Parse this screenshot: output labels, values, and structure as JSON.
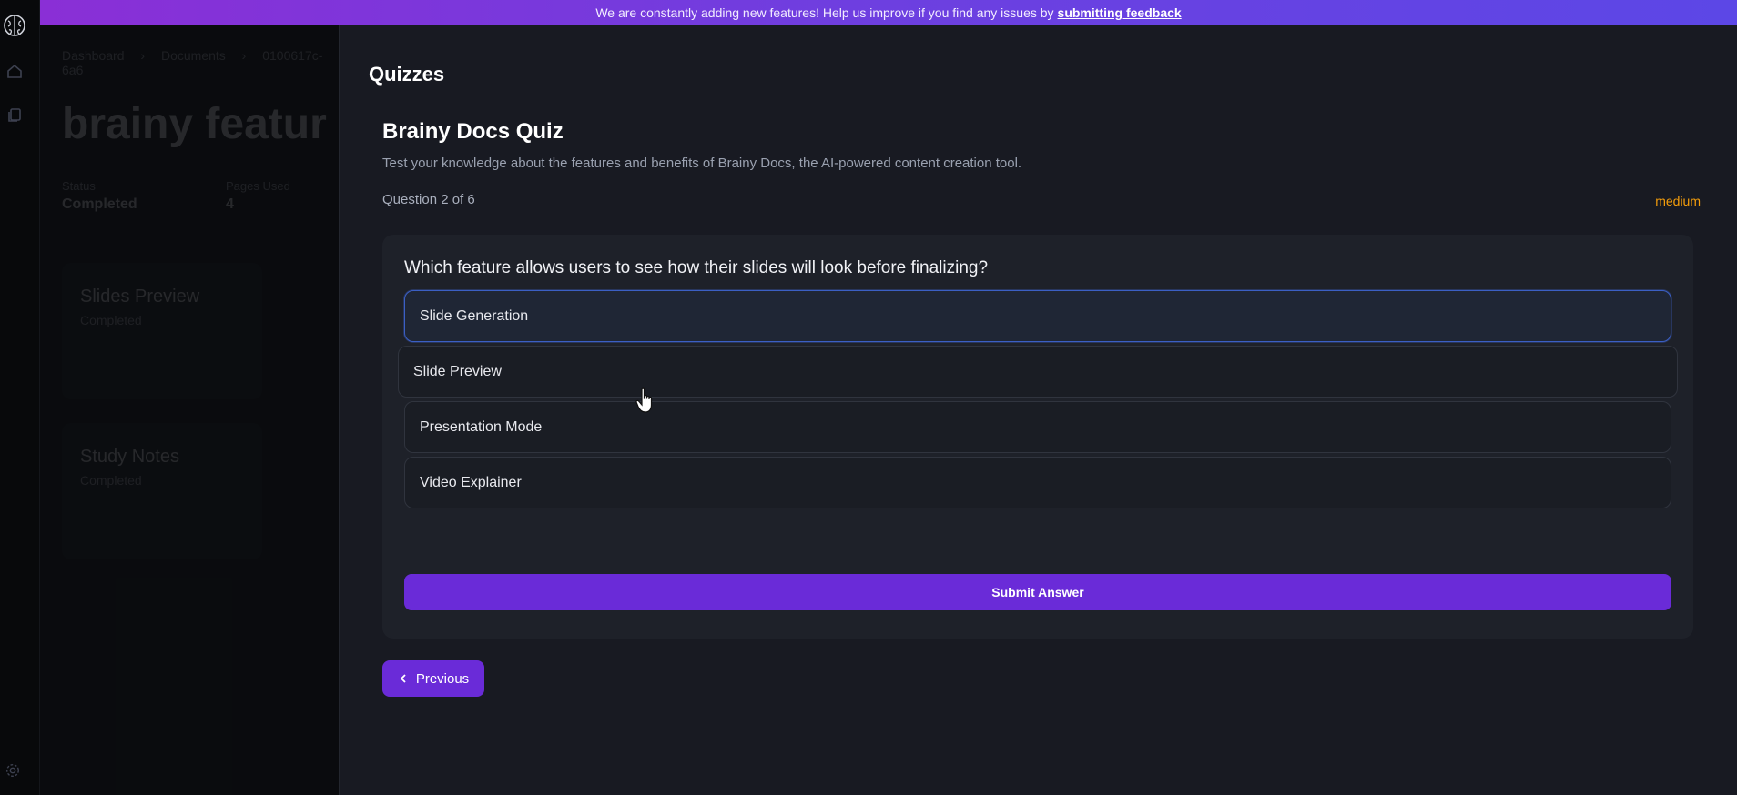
{
  "banner": {
    "text": "We are constantly adding new features! Help us improve if you find any issues by",
    "link": "submitting feedback"
  },
  "sidebar": {
    "icons": [
      "brain-logo-icon",
      "home-icon",
      "documents-icon",
      "gear-icon"
    ]
  },
  "background": {
    "breadcrumb": [
      "Dashboard",
      "Documents",
      "0100617c-6a6"
    ],
    "title": "brainy featur",
    "status_label": "Status",
    "status_value": "Completed",
    "pages_label": "Pages Used",
    "pages_value": "4",
    "cards": [
      {
        "title": "Slides Preview",
        "status": "Completed"
      },
      {
        "title": "Study Notes",
        "status": "Completed"
      }
    ]
  },
  "panel": {
    "title": "Quizzes",
    "quiz_title": "Brainy Docs Quiz",
    "quiz_description": "Test your knowledge about the features and benefits of Brainy Docs, the AI-powered content creation tool.",
    "progress": "Question 2 of 6",
    "difficulty": "medium",
    "question": "Which feature allows users to see how their slides will look before finalizing?",
    "options": [
      "Slide Generation",
      "Slide Preview",
      "Presentation Mode",
      "Video Explainer"
    ],
    "selected_option": "Slide Generation",
    "submit_label": "Submit Answer",
    "previous_label": "Previous"
  },
  "colors": {
    "accent": "#6a2bd8",
    "difficulty": "#f59e0b",
    "selected_border": "#3b5fc4"
  }
}
